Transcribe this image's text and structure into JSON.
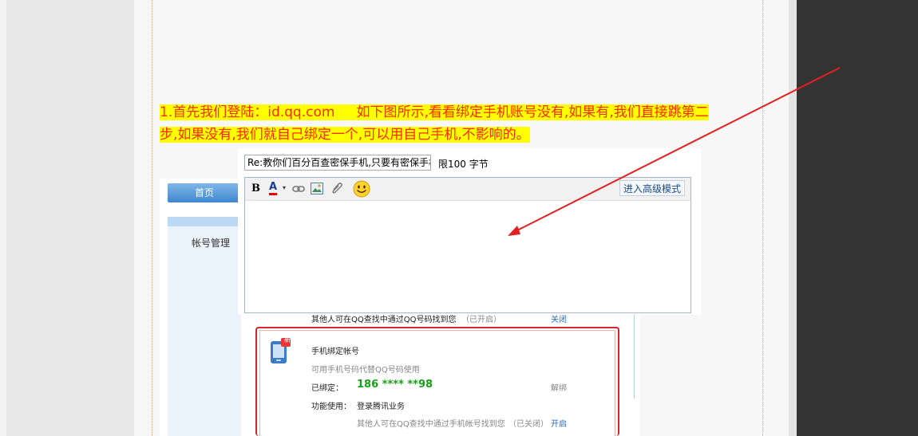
{
  "paragraph": {
    "line1": "1.首先我们登陆：id.qq.com     如下图所示,看看绑定手机账号没有,如果有,我们直接跳第二",
    "line2": "步,如果没有,我们就自己绑定一个,可以用自己手机,不影响的。"
  },
  "editor": {
    "title_value": "Re:教你们百分百查密保手机,只要有密保手机",
    "limit_text": "限100 字节",
    "toolbar": {
      "bold": "B",
      "font_color": "A",
      "advanced_mode": "进入高级模式"
    },
    "body_value": ""
  },
  "screenshot": {
    "nav_home": "首页",
    "side_label": "帐号管理",
    "row_find": "其他人可在QQ查找中通过QQ号码找到您",
    "row_find_status": "（已开启）",
    "row_find_action": "关闭",
    "new_badge": "新",
    "card_title": "手机绑定帐号",
    "card_desc": "可用手机号码代替QQ号码使用",
    "bound_label": "已绑定：",
    "bound_number": "186 **** **98",
    "unbind": "解绑",
    "func_label": "功能使用：",
    "func_value": "登录腾讯业务",
    "phone_find": "其他人可在QQ查找中通过手机帐号找到您",
    "phone_find_status": "（已关闭）",
    "phone_find_action": "开启"
  },
  "colors": {
    "text_red": "#ff2a00",
    "highlight": "#ffff00",
    "arrow": "#e52020",
    "card_border": "#d7262a",
    "dark_panel": "#333333"
  }
}
